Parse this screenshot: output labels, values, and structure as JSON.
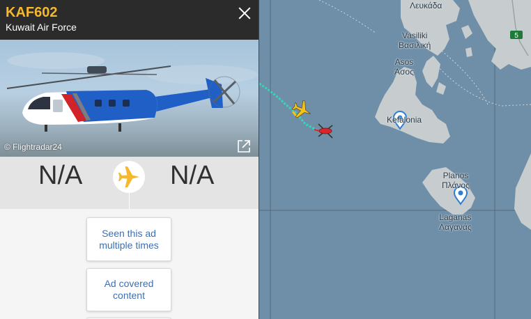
{
  "flight": {
    "callsign": "KAF602",
    "operator": "Kuwait Air Force",
    "photo_credit": "© Flightradar24",
    "origin": "N/A",
    "destination": "N/A"
  },
  "ad_feedback": {
    "option1": "Seen this ad multiple times",
    "option2": "Ad covered content"
  },
  "map": {
    "labels": {
      "lefkada": "Λευκάδα",
      "vasiliki_latin": "Vasiliki",
      "vasiliki_greek": "Βασιλική",
      "asos_latin": "Asos",
      "asos_greek": "Άσος",
      "kefalonia": "Kefalonia",
      "planos_latin": "Planos",
      "planos_greek": "Πλάνος",
      "laganas_latin": "Laganas",
      "laganas_greek": "Λαγανάς",
      "road_number": "5"
    }
  },
  "colors": {
    "callsign": "#f5b82e",
    "header_bg": "#2b2b2b",
    "sea": "#6f8fa8",
    "land": "#c7cdcf",
    "track": "#37d6b8",
    "aircraft_selected": "#f5c21b",
    "aircraft_other": "#d9262a",
    "link_blue": "#3b6fb6",
    "pin": "#2f7fd0"
  },
  "icons": {
    "close": "close-icon",
    "external_link": "external-link-icon",
    "route_plane": "airplane-icon",
    "map_pin": "location-pin-icon"
  }
}
